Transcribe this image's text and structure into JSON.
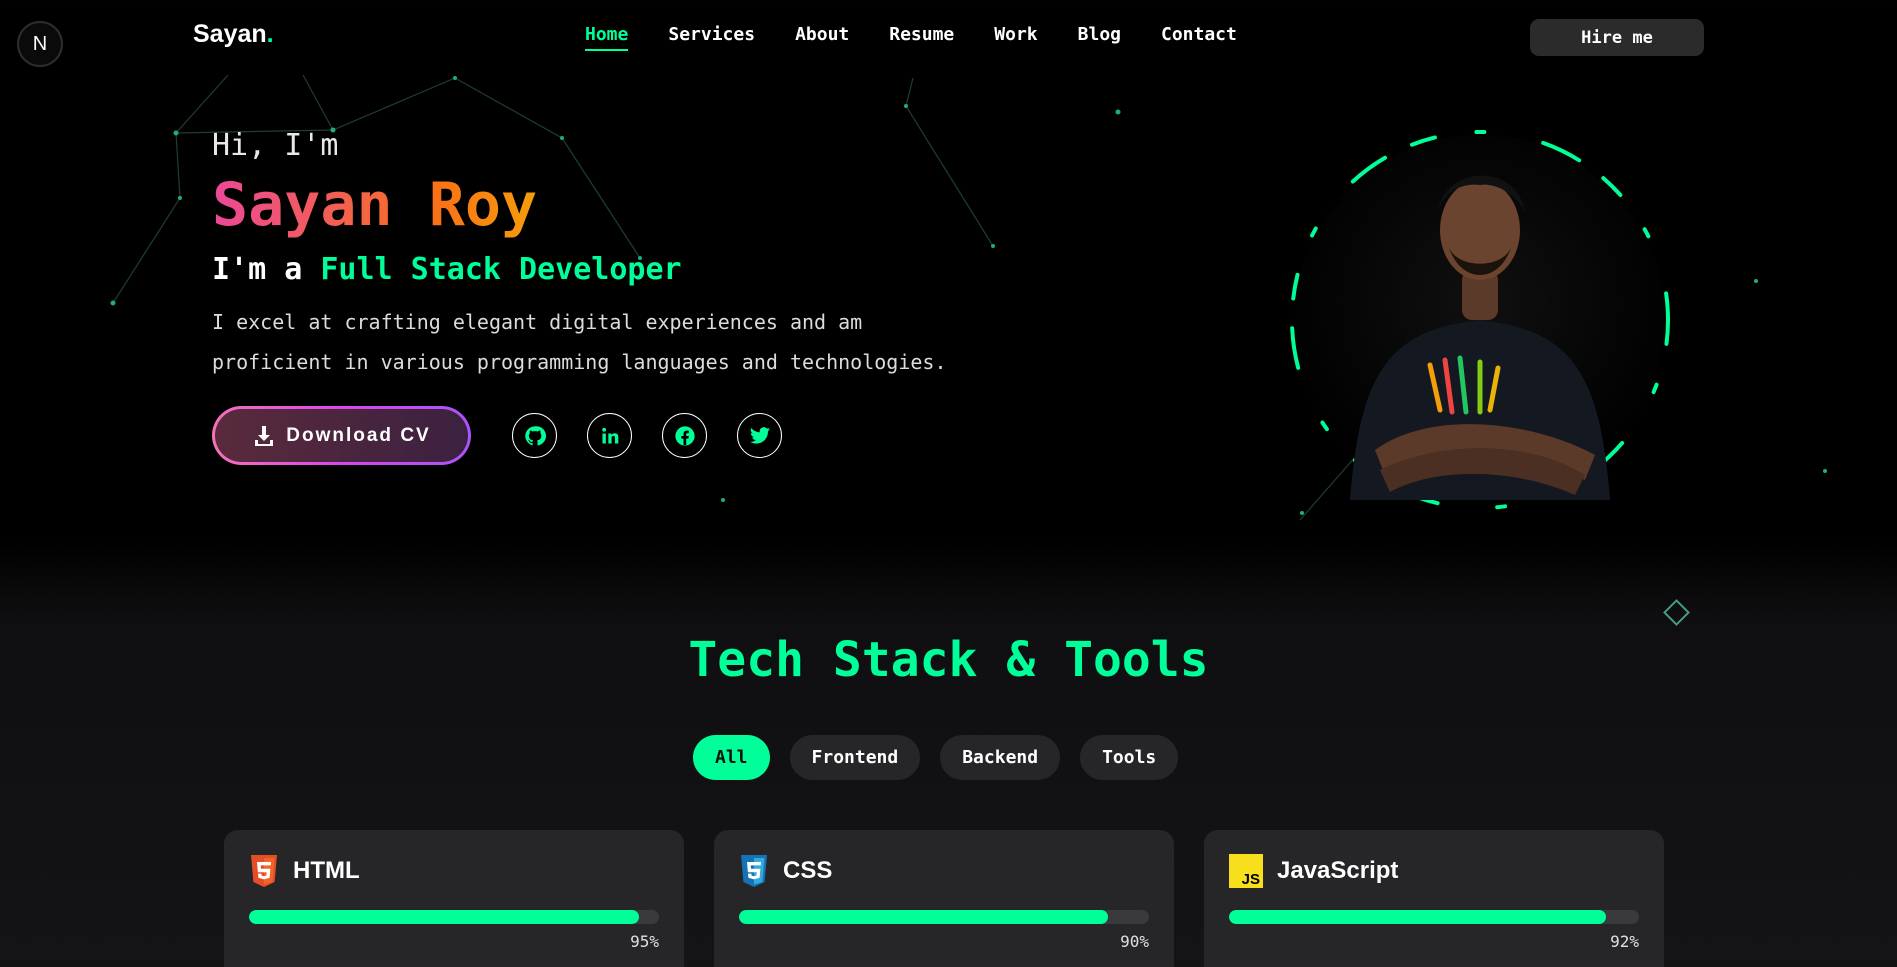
{
  "badge": "N",
  "logo": {
    "name": "Sayan",
    "dot": "."
  },
  "nav": [
    "Home",
    "Services",
    "About",
    "Resume",
    "Work",
    "Blog",
    "Contact"
  ],
  "hire_label": "Hire me",
  "hero": {
    "greeting": "Hi, I'm",
    "name": "Sayan Roy",
    "role_prefix": "I'm a ",
    "role": "Full Stack Developer",
    "description": "I excel at crafting elegant digital experiences and am proficient in various programming languages and technologies.",
    "cv_label": "Download CV",
    "socials": [
      "github-icon",
      "linkedin-icon",
      "facebook-icon",
      "twitter-icon"
    ]
  },
  "section": {
    "title": "Tech Stack & Tools"
  },
  "filters": [
    "All",
    "Frontend",
    "Backend",
    "Tools"
  ],
  "skills": [
    {
      "name": "HTML",
      "percent": 95,
      "label": "95%",
      "icon": "html5-icon",
      "color": "#f16529"
    },
    {
      "name": "CSS",
      "percent": 90,
      "label": "90%",
      "icon": "css3-icon",
      "color": "#2965f1"
    },
    {
      "name": "JavaScript",
      "percent": 92,
      "label": "92%",
      "icon": "javascript-icon",
      "color": "#f7df1e"
    }
  ],
  "colors": {
    "accent": "#00ff99",
    "background": "#000000",
    "card": "#262628"
  }
}
